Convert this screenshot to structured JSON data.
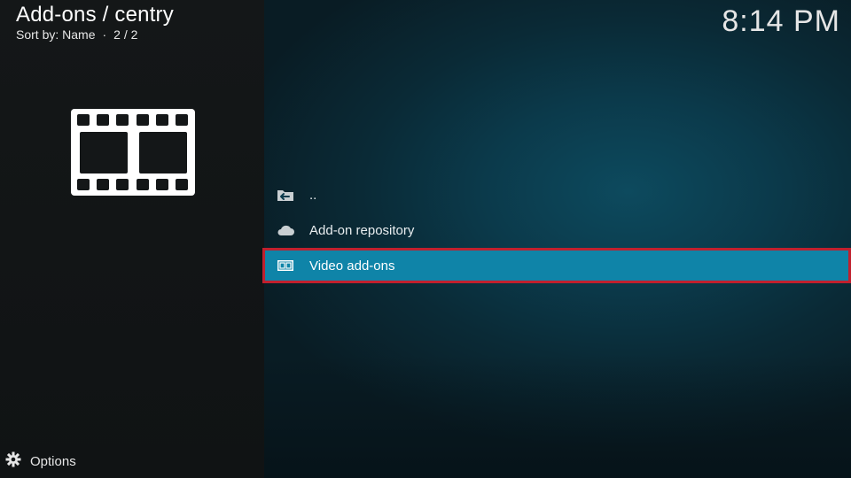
{
  "header": {
    "title": "Add-ons / centry",
    "sort_label": "Sort by: Name",
    "page_count": "2 / 2"
  },
  "clock": "8:14 PM",
  "thumbnail": {
    "icon": "film-strip-icon"
  },
  "list": {
    "items": [
      {
        "label": "..",
        "icon": "back-folder-icon"
      },
      {
        "label": "Add-on repository",
        "icon": "cloud-icon"
      },
      {
        "label": "Video add-ons",
        "icon": "film-icon",
        "focused": true
      }
    ]
  },
  "footer": {
    "options_label": "Options",
    "icon": "gear-icon"
  },
  "colors": {
    "focus_bg": "#0f84a8",
    "focus_outline": "#c0202e",
    "left_panel": "#141718",
    "right_panel": "#0b3a4b"
  }
}
